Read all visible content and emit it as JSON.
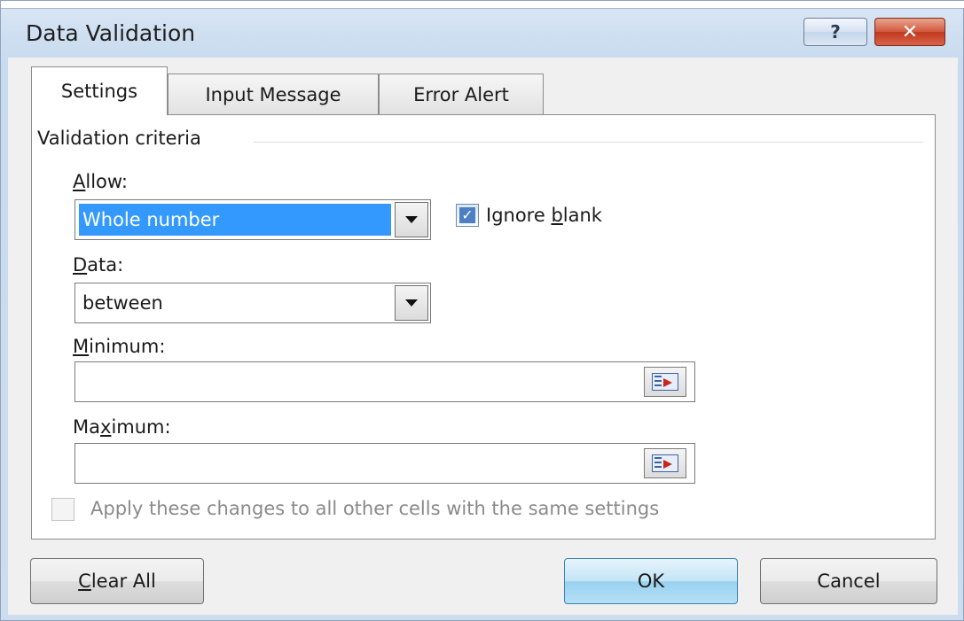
{
  "dialog": {
    "title": "Data Validation",
    "help_icon": "?",
    "close_icon": "✕"
  },
  "tabs": [
    {
      "label": "Settings",
      "active": true
    },
    {
      "label": "Input Message",
      "active": false
    },
    {
      "label": "Error Alert",
      "active": false
    }
  ],
  "settings": {
    "group_title": "Validation criteria",
    "allow": {
      "label_accel": "A",
      "label_rest": "llow:",
      "value": "Whole number"
    },
    "ignore_blank": {
      "label_pre": "Ignore ",
      "label_accel": "b",
      "label_post": "lank",
      "checked": true
    },
    "data": {
      "label_accel": "D",
      "label_rest": "ata:",
      "value": "between"
    },
    "minimum": {
      "label_accel": "M",
      "label_rest": "inimum:",
      "value": ""
    },
    "maximum": {
      "label_pre": "Ma",
      "label_accel": "x",
      "label_post": "imum:",
      "value": ""
    },
    "apply_all": {
      "label": "Apply these changes to all other cells with the same settings",
      "checked": false,
      "enabled": false
    }
  },
  "buttons": {
    "clear_accel": "C",
    "clear_rest": "lear All",
    "ok": "OK",
    "cancel": "Cancel"
  },
  "colors": {
    "selection": "#3399ff",
    "close_button": "#c0391e",
    "checkbox_check": "#4c7fc4"
  }
}
